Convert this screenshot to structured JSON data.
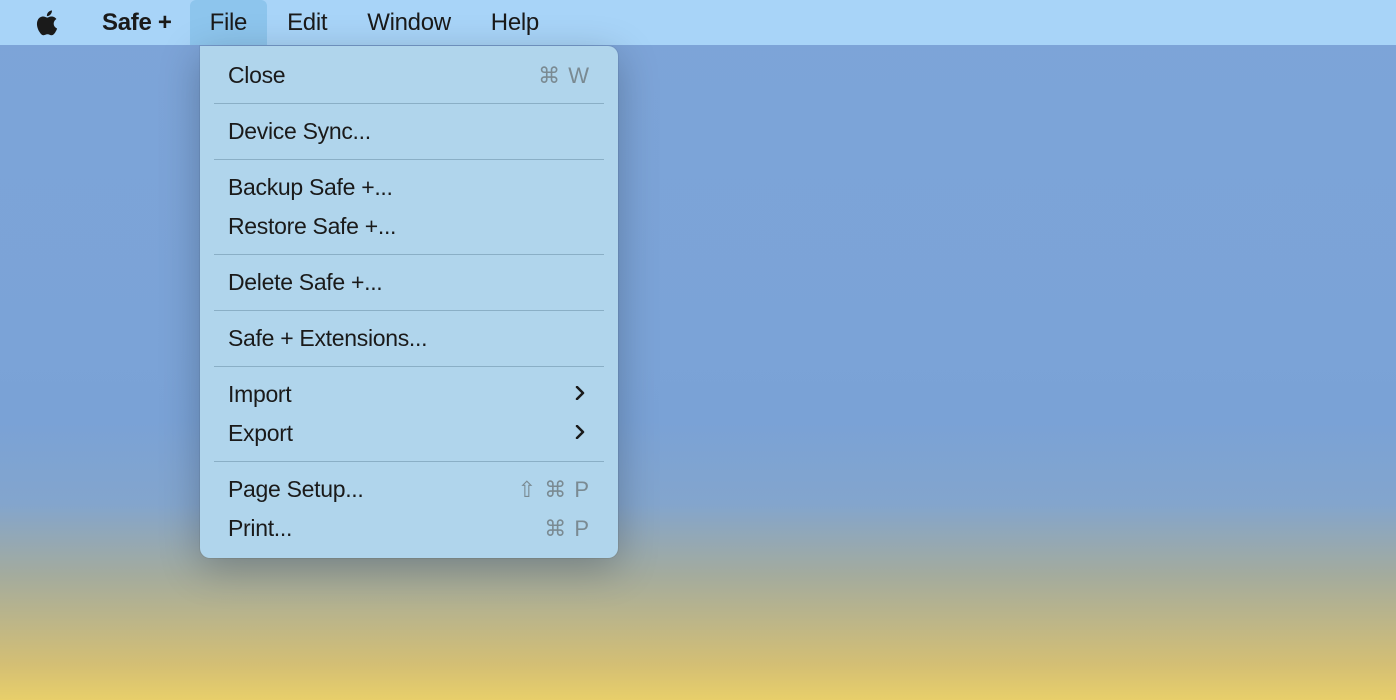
{
  "menubar": {
    "app_name": "Safe +",
    "items": [
      {
        "label": "File",
        "active": true
      },
      {
        "label": "Edit",
        "active": false
      },
      {
        "label": "Window",
        "active": false
      },
      {
        "label": "Help",
        "active": false
      }
    ]
  },
  "file_menu": {
    "groups": [
      [
        {
          "label": "Close",
          "shortcut": "⌘ W"
        }
      ],
      [
        {
          "label": "Device Sync..."
        }
      ],
      [
        {
          "label": "Backup Safe +..."
        },
        {
          "label": "Restore Safe +..."
        }
      ],
      [
        {
          "label": "Delete Safe +..."
        }
      ],
      [
        {
          "label": "Safe + Extensions..."
        }
      ],
      [
        {
          "label": "Import",
          "submenu": true
        },
        {
          "label": "Export",
          "submenu": true
        }
      ],
      [
        {
          "label": "Page Setup...",
          "shortcut": "⇧ ⌘ P"
        },
        {
          "label": "Print...",
          "shortcut": "⌘ P"
        }
      ]
    ]
  }
}
